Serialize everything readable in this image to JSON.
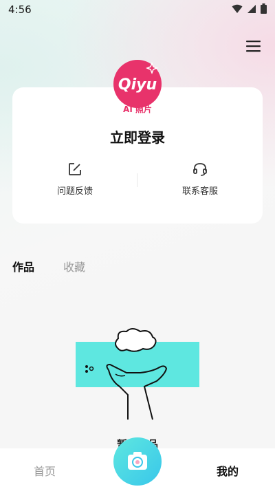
{
  "status_bar": {
    "time": "4:56"
  },
  "logo": {
    "brand_text": "Qiyu",
    "sub_text": "AI 照片"
  },
  "profile_card": {
    "login_label": "立即登录"
  },
  "actions": [
    {
      "label": "问题反馈",
      "icon": "edit-icon"
    },
    {
      "label": "联系客服",
      "icon": "headset-icon"
    }
  ],
  "tabs": [
    {
      "label": "作品",
      "active": true
    },
    {
      "label": "收藏",
      "active": false
    }
  ],
  "empty_state": {
    "text": "暂无作品"
  },
  "bottom_nav": {
    "home_label": "首页",
    "mine_label": "我的",
    "center_icon": "camera-icon"
  },
  "colors": {
    "accent_pink": "#e8336b",
    "accent_cyan": "#5ee7e0",
    "text_dark": "#111111",
    "text_muted": "#999999"
  }
}
